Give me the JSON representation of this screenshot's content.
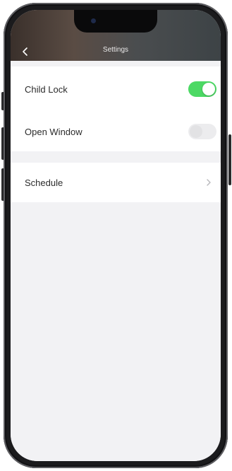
{
  "header": {
    "title": "Settings",
    "back_icon": "chevron-left-icon"
  },
  "settings": {
    "child_lock": {
      "label": "Child Lock",
      "enabled": true
    },
    "open_window": {
      "label": "Open Window",
      "enabled": false
    },
    "schedule": {
      "label": "Schedule",
      "icon": "chevron-right-icon"
    }
  },
  "colors": {
    "toggle_on": "#4cd964",
    "toggle_off": "#ececee",
    "background": "#f2f2f4"
  }
}
